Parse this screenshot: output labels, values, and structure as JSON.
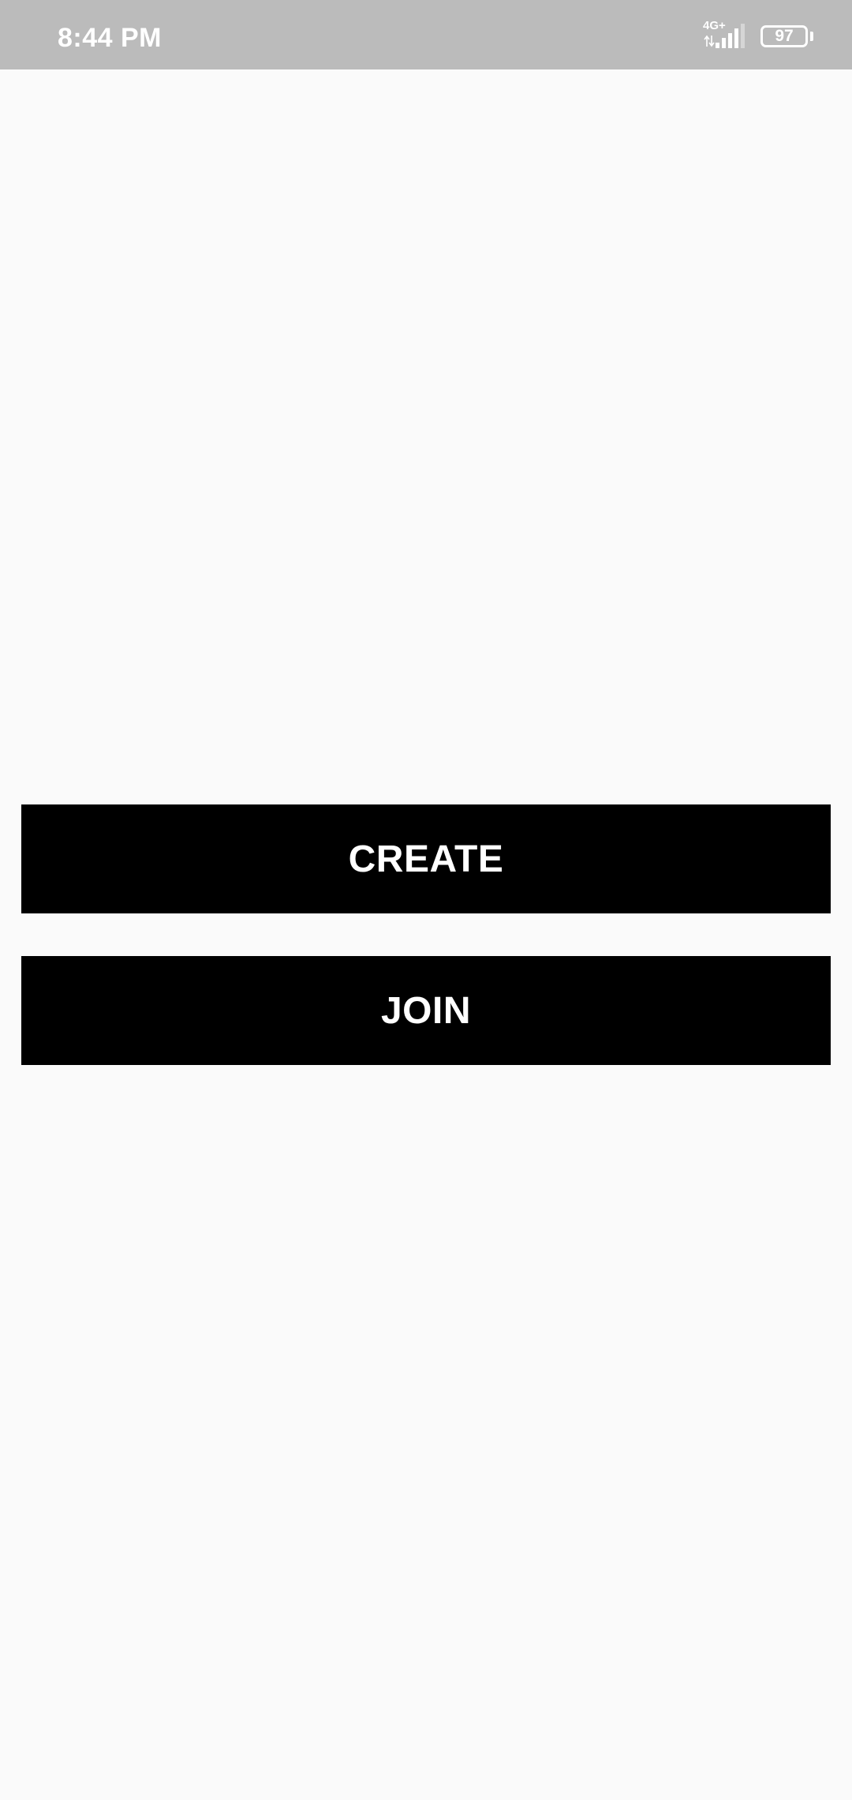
{
  "status_bar": {
    "time": "8:44 PM",
    "network_type": "4G+",
    "signal_icon": "signal-strength-icon",
    "battery_level": "97",
    "background_color": "#bbbbbb"
  },
  "main": {
    "create_label": "CREATE",
    "join_label": "JOIN",
    "button_color": "#000000",
    "button_text_color": "#ffffff",
    "background_color": "#fafafa"
  }
}
